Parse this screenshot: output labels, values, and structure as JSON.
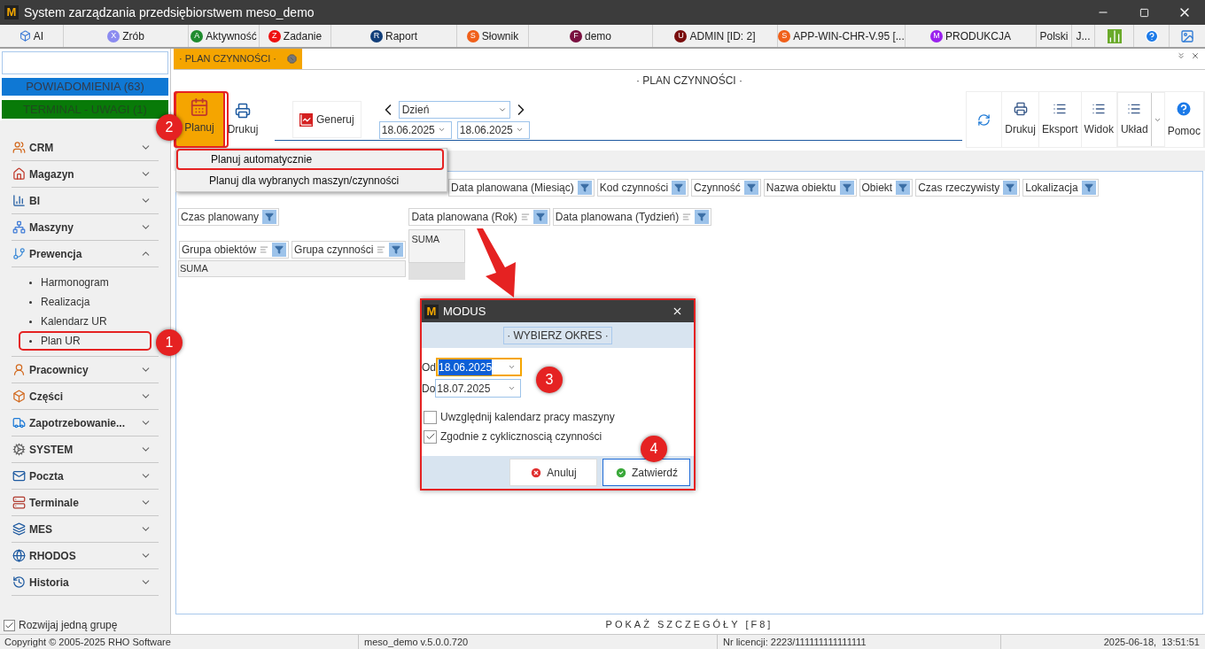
{
  "window": {
    "logo": "M",
    "title": "System zarządzania przedsiębiorstwem meso_demo"
  },
  "toolbar": [
    {
      "kind": "icon",
      "label": "AI"
    },
    {
      "kind": "badge",
      "badge": "X",
      "color": "#8b8bf0",
      "label": "Zrób"
    },
    {
      "kind": "badge",
      "badge": "A",
      "color": "#1f8b2e",
      "label": "Aktywność"
    },
    {
      "kind": "badge",
      "badge": "Z",
      "color": "#ee1111",
      "label": "Zadanie"
    },
    {
      "kind": "badge",
      "badge": "R",
      "color": "#123f7a",
      "label": "Raport"
    },
    {
      "kind": "badge",
      "badge": "S",
      "color": "#f0601a",
      "label": "Słownik"
    },
    {
      "kind": "badge",
      "badge": "F",
      "color": "#7a1040",
      "label": "demo"
    },
    {
      "kind": "badge",
      "badge": "U",
      "color": "#7a0e0e",
      "label": "ADMIN [ID: 2]"
    },
    {
      "kind": "badge",
      "badge": "S",
      "color": "#f0601a",
      "label": "APP-WIN-CHR-V.95 [..."
    },
    {
      "kind": "badge",
      "badge": "M",
      "color": "#9a22ee",
      "label": "PRODUKCJA"
    },
    {
      "kind": "text",
      "label": "Polski"
    },
    {
      "kind": "text",
      "label": "J..."
    }
  ],
  "sidebar": {
    "notifications": "POWIADOMIENIA (63)",
    "terminal": "TERMINAL - UWAGI (1)",
    "groups": [
      {
        "label": "CRM",
        "expanded": false
      },
      {
        "label": "Magazyn",
        "expanded": false
      },
      {
        "label": "BI",
        "expanded": false
      },
      {
        "label": "Maszyny",
        "expanded": false
      },
      {
        "label": "Prewencja",
        "expanded": true,
        "children": [
          {
            "label": "Harmonogram",
            "highlighted": false
          },
          {
            "label": "Realizacja",
            "highlighted": false
          },
          {
            "label": "Kalendarz UR",
            "highlighted": false
          },
          {
            "label": "Plan UR",
            "highlighted": true
          }
        ]
      },
      {
        "label": "Pracownicy",
        "expanded": false
      },
      {
        "label": "Części",
        "expanded": false
      },
      {
        "label": "Zapotrzebowanie...",
        "expanded": false
      },
      {
        "label": "SYSTEM",
        "expanded": false
      },
      {
        "label": "Poczta",
        "expanded": false
      },
      {
        "label": "Terminale",
        "expanded": false
      },
      {
        "label": "MES",
        "expanded": false
      },
      {
        "label": "RHODOS",
        "expanded": false
      },
      {
        "label": "Historia",
        "expanded": false
      }
    ],
    "expand_one": {
      "label": "Rozwijaj jedną grupę",
      "checked": true
    }
  },
  "tab": {
    "label": "· PLAN CZYNNOŚCI ·",
    "selected": true
  },
  "page_title": "· PLAN CZYNNOŚCI ·",
  "ribbon": {
    "left": [
      {
        "label": "Planuj",
        "selected": true
      },
      {
        "label": "Drukuj",
        "selected": false
      }
    ],
    "generate": "Generuj",
    "period": "Dzień",
    "date_from": "18.06.2025",
    "date_to": "18.06.2025",
    "right": [
      {
        "kind": "refresh"
      },
      {
        "kind": "print",
        "label": "Drukuj"
      },
      {
        "kind": "list",
        "label": "Eksport"
      },
      {
        "kind": "list",
        "label": "Widok"
      },
      {
        "kind": "split",
        "label": "Układ"
      },
      {
        "kind": "help",
        "label": "Pomoc"
      }
    ]
  },
  "menu": [
    {
      "label": "Planuj automatycznie",
      "highlighted": true
    },
    {
      "label": "Planuj dla wybranych maszyn/czynności",
      "highlighted": false
    }
  ],
  "pivot": {
    "filter_fields": [
      {
        "label": "Data planowana (Miesiąc)",
        "sorted": false
      },
      {
        "label": "Kod czynności",
        "sorted": false
      },
      {
        "label": "Czynność",
        "sorted": false
      },
      {
        "label": "Nazwa obiektu",
        "sorted": false
      },
      {
        "label": "Obiekt",
        "sorted": false
      },
      {
        "label": "Czas rzeczywisty",
        "sorted": false
      },
      {
        "label": "Lokalizacja",
        "sorted": false
      }
    ],
    "data_fields": [
      {
        "label": "Czas planowany",
        "sorted": false
      }
    ],
    "column_fields": [
      {
        "label": "Data planowana (Rok)",
        "sorted": true
      },
      {
        "label": "Data planowana (Tydzień)",
        "sorted": true
      }
    ],
    "row_fields": [
      {
        "label": "Grupa obiektów",
        "sorted": true
      },
      {
        "label": "Grupa czynności",
        "sorted": true
      }
    ],
    "column_total": "SUMA",
    "row_total": "SUMA"
  },
  "details_button": "POKAŻ SZCZEGÓŁY [F8]",
  "dialog": {
    "logo": "M",
    "title": "MODUS",
    "header": "· WYBIERZ OKRES ·",
    "fields": [
      {
        "label": "Od",
        "value": "18.06.2025",
        "focused": true
      },
      {
        "label": "Do",
        "value": "18.07.2025",
        "focused": false
      }
    ],
    "options": [
      {
        "label": "Uwzględnij kalendarz pracy maszyny",
        "checked": false
      },
      {
        "label": "Zgodnie z cyklicznoscią czynności",
        "checked": true
      }
    ],
    "buttons": [
      {
        "label": "Anuluj",
        "kind": "cancel"
      },
      {
        "label": "Zatwierdź",
        "kind": "confirm"
      }
    ]
  },
  "annotations": [
    {
      "number": "1"
    },
    {
      "number": "2"
    },
    {
      "number": "3"
    },
    {
      "number": "4"
    }
  ],
  "status_bar": [
    "Copyright © 2005-2025 RHO Software",
    "meso_demo v.5.0.0.720",
    "Nr licencji: 2223/111111111111111",
    "2025-06-18,  13:51:51"
  ]
}
